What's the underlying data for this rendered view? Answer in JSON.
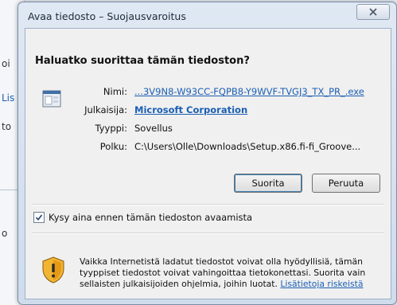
{
  "background": {
    "fragments": [
      "oi",
      "Lis",
      "to",
      "o"
    ]
  },
  "dialog": {
    "title": "Avaa tiedosto – Suojausvaroitus",
    "heading": "Haluatko suorittaa tämän tiedoston?",
    "fields": [
      {
        "label": "Nimi:",
        "value": "...3V9N8-W93CC-FQPB8-Y9WVF-TVGJ3_TX_PR_.exe"
      },
      {
        "label": "Julkaisija:",
        "value": "Microsoft Corporation"
      },
      {
        "label": "Tyyppi:",
        "value": "Sovellus"
      },
      {
        "label": "Polku:",
        "value": "C:\\Users\\Olle\\Downloads\\Setup.x86.fi-fi_Groove..."
      }
    ],
    "buttons": {
      "run": "Suorita",
      "cancel": "Peruuta"
    },
    "checkbox": {
      "label": "Kysy aina ennen tämän tiedoston avaamista",
      "checked": true
    },
    "warning": {
      "text": "Vaikka Internetistä ladatut tiedostot voivat olla hyödyllisiä, tämän tyyppiset tiedostot voivat vahingoittaa tietokonettasi. Suorita vain sellaisten julkaisijoiden ohjelmia, joihin luotat.",
      "link": "Lisätietoja riskeistä"
    }
  },
  "icons": {
    "close": "close-icon",
    "file": "application-file-icon",
    "checkbox": "checkmark-icon",
    "shield": "security-shield-icon"
  },
  "colors": {
    "link": "#1b5fb3",
    "frame": "#cfdcec",
    "content": "#f0f0f0"
  }
}
